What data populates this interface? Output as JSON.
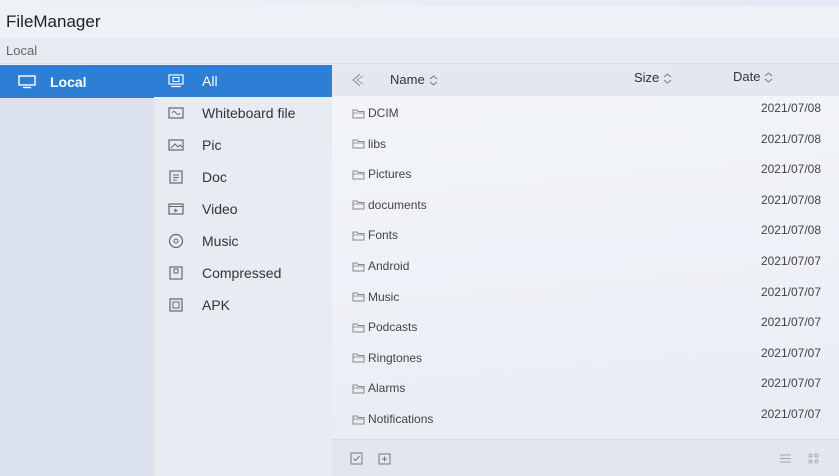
{
  "app": {
    "title": "FileManager"
  },
  "breadcrumb": {
    "path": "Local"
  },
  "sidebar": {
    "items": [
      {
        "label": "Local",
        "icon": "monitor-icon",
        "active": true
      }
    ]
  },
  "categories": [
    {
      "label": "All",
      "icon": "all-files-icon",
      "active": true
    },
    {
      "label": "Whiteboard file",
      "icon": "whiteboard-icon",
      "active": false
    },
    {
      "label": "Pic",
      "icon": "picture-icon",
      "active": false
    },
    {
      "label": "Doc",
      "icon": "document-icon",
      "active": false
    },
    {
      "label": "Video",
      "icon": "video-icon",
      "active": false
    },
    {
      "label": "Music",
      "icon": "music-icon",
      "active": false
    },
    {
      "label": "Compressed",
      "icon": "archive-icon",
      "active": false
    },
    {
      "label": "APK",
      "icon": "apk-icon",
      "active": false
    }
  ],
  "table": {
    "columns": {
      "name": "Name",
      "size": "Size",
      "date": "Date"
    },
    "rows": [
      {
        "name": "DCIM",
        "date": "2021/07/08"
      },
      {
        "name": "libs",
        "date": "2021/07/08"
      },
      {
        "name": "Pictures",
        "date": "2021/07/08"
      },
      {
        "name": "documents",
        "date": "2021/07/08"
      },
      {
        "name": "Fonts",
        "date": "2021/07/08"
      },
      {
        "name": "Android",
        "date": "2021/07/07"
      },
      {
        "name": "Music",
        "date": "2021/07/07"
      },
      {
        "name": "Podcasts",
        "date": "2021/07/07"
      },
      {
        "name": "Ringtones",
        "date": "2021/07/07"
      },
      {
        "name": "Alarms",
        "date": "2021/07/07"
      },
      {
        "name": "Notifications",
        "date": "2021/07/07"
      }
    ]
  },
  "footer": {
    "left_icons": [
      "select-all-icon",
      "new-folder-icon"
    ],
    "right_icons": [
      "list-view-icon",
      "grid-view-icon"
    ]
  },
  "colors": {
    "accent": "#2d7fd6"
  }
}
